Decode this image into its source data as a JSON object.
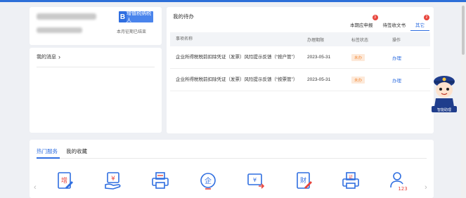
{
  "profile": {
    "badge_letter": "B",
    "taxpayer_type": "增值税纳税人",
    "period_note": "本月征期已结束"
  },
  "messages": {
    "title": "我的消息",
    "arrow": "›"
  },
  "todo": {
    "title": "我的待办",
    "tabs": [
      {
        "label": "本期应申报",
        "count": "3"
      },
      {
        "label": "待签收文书",
        "count": ""
      },
      {
        "label": "其它",
        "count": "2"
      }
    ],
    "columns": [
      "事项名称",
      "办理期限",
      "标签状态",
      "操作"
    ],
    "rows": [
      {
        "name": "企业所得税税前扣除凭证（发票）风险提示反馈（“按户管”）",
        "date": "2023-05-31",
        "status": "未办",
        "action": "办理"
      },
      {
        "name": "企业所得税税前扣除凭证（发票）风险提示反馈（“按票管”）",
        "date": "2023-05-31",
        "status": "未办",
        "action": "办理"
      }
    ]
  },
  "services": {
    "tabs": [
      "热门服务",
      "我的收藏"
    ],
    "icons": [
      "vat-invoice-icon",
      "tax-payment-icon",
      "print-icon",
      "enterprise-icon",
      "invoice-transfer-icon",
      "financial-report-icon",
      "certificate-print-icon",
      "user-account-icon"
    ],
    "icon_glyphs": [
      "增",
      "¥",
      "",
      "企",
      "¥",
      "财",
      "证",
      "123"
    ],
    "prev_arrow": "‹",
    "next_arrow": "›"
  },
  "mascot": {
    "caption": "智能助理"
  },
  "colors": {
    "accent": "#2f6ee0",
    "badge_red": "#e8453c",
    "status_orange": "#f28b3b"
  }
}
